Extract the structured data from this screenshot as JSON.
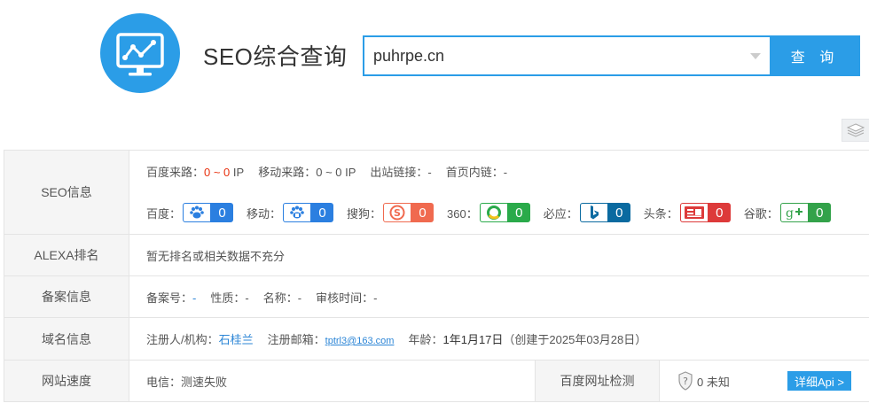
{
  "header": {
    "title": "SEO综合查询",
    "search_value": "puhrpe.cn",
    "search_button": "查 询",
    "brand_color": "#2b9de7"
  },
  "seo": {
    "label": "SEO信息",
    "baidu_traffic_label": "百度来路：",
    "baidu_traffic_value": "0 ~ 0",
    "baidu_traffic_unit": "IP",
    "mobile_traffic_label": "移动来路：",
    "mobile_traffic_value": "0 ~ 0 IP",
    "outbound_label": "出站链接：",
    "outbound_value": "-",
    "homepage_internal_label": "首页内链：",
    "homepage_internal_value": "-",
    "engines": [
      {
        "label": "百度：",
        "value": "0",
        "color": "#2b7fe0",
        "icon": "baidu-paw-icon"
      },
      {
        "label": "移动：",
        "value": "0",
        "color": "#2b7fe0",
        "icon": "baidu-mobile-icon"
      },
      {
        "label": "搜狗：",
        "value": "0",
        "color": "#f06a4f",
        "icon": "sogou-icon"
      },
      {
        "label": "360：",
        "value": "0",
        "color": "#2aaa4a",
        "icon": "so360-icon"
      },
      {
        "label": "必应：",
        "value": "0",
        "color": "#0a6aa0",
        "icon": "bing-icon"
      },
      {
        "label": "头条：",
        "value": "0",
        "color": "#dd3a3a",
        "icon": "toutiao-icon"
      },
      {
        "label": "谷歌：",
        "value": "0",
        "color": "#33a24a",
        "icon": "google-plus-icon"
      }
    ]
  },
  "alexa": {
    "label": "ALEXA排名",
    "value": "暂无排名或相关数据不充分"
  },
  "beian": {
    "label": "备案信息",
    "number_label": "备案号：",
    "number_value": "-",
    "nature_label": "性质：",
    "nature_value": "-",
    "name_label": "名称：",
    "name_value": "-",
    "audit_label": "审核时间：",
    "audit_value": "-"
  },
  "domain": {
    "label": "域名信息",
    "registrant_label": "注册人/机构：",
    "registrant_value": "石桂兰",
    "email_label": "注册邮箱：",
    "email_value": "tptrl3@163.com",
    "age_label": "年龄：",
    "age_value": "1年1月17日",
    "created_text": "（创建于2025年03月28日）"
  },
  "speed": {
    "label": "网站速度",
    "telecom_text": "电信：测速失败",
    "baidu_check_label": "百度网址检测",
    "status_value": "0 未知",
    "api_button": "详细Api >"
  }
}
